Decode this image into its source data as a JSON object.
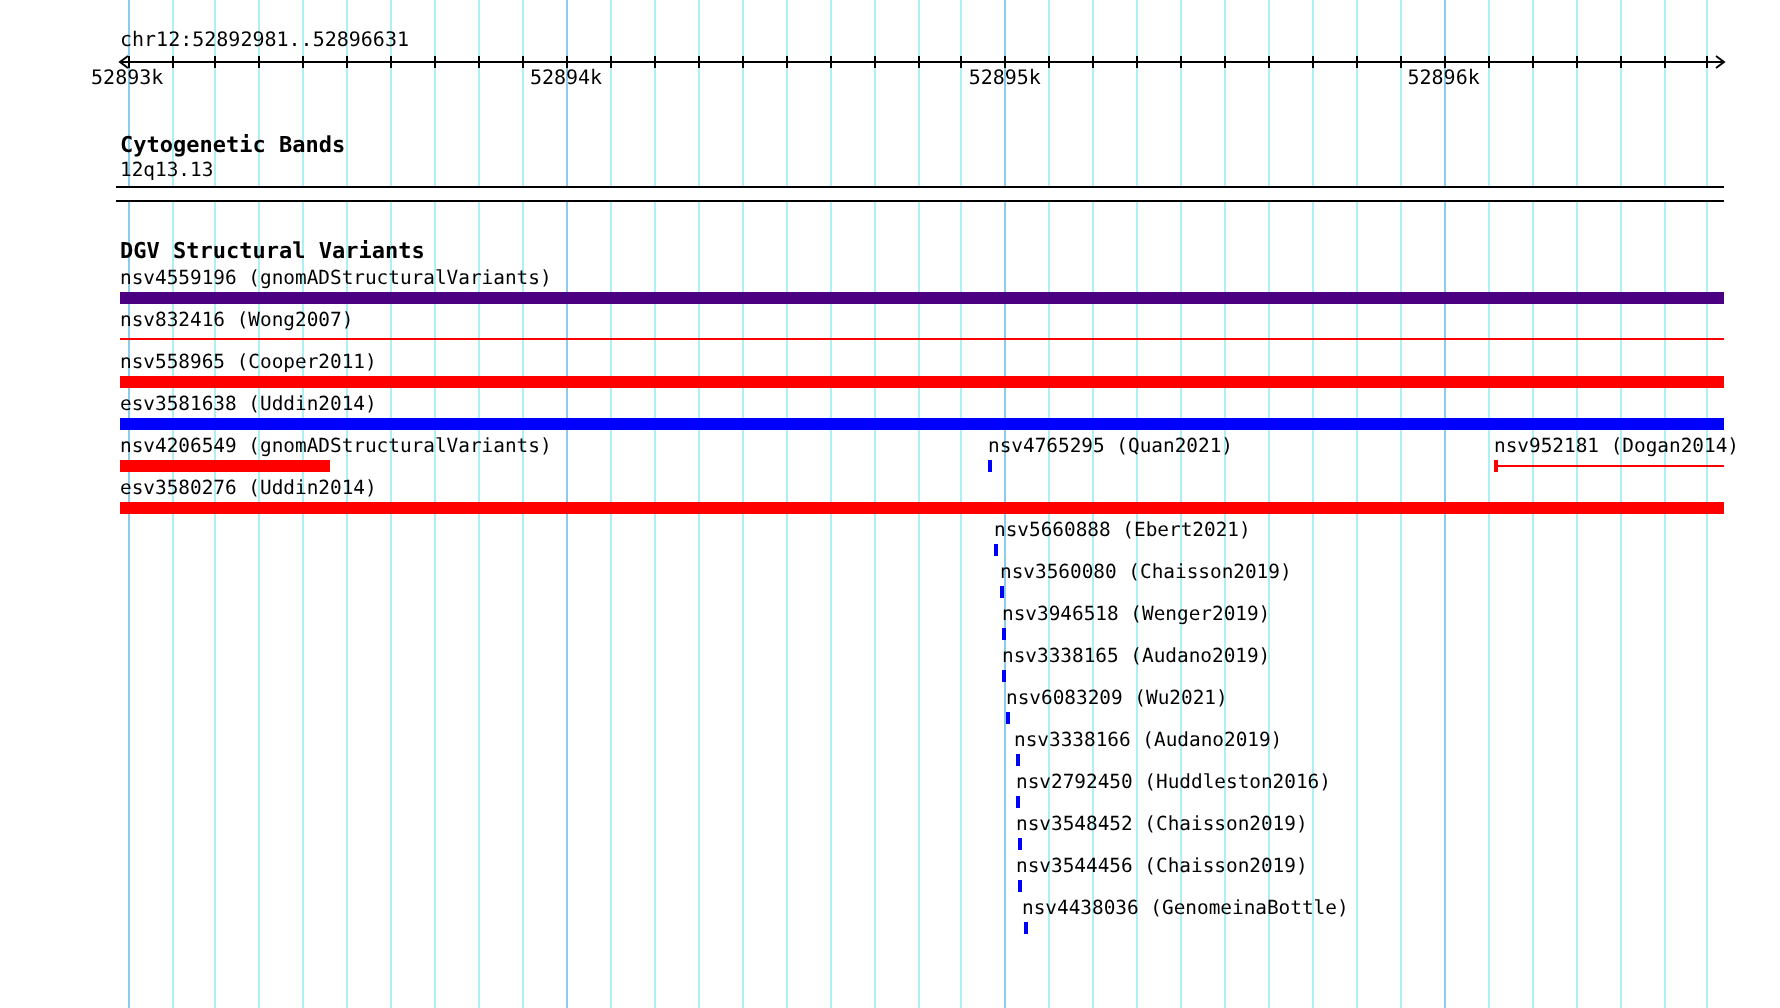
{
  "ruler": {
    "region": "chr12:52892981..52896631",
    "ticks": [
      "52893k",
      "52894k",
      "52895k",
      "52896k"
    ]
  },
  "tracks": [
    {
      "title": "Cytogenetic Bands",
      "kind": "bands",
      "features": [
        {
          "label": "12q13.13"
        }
      ]
    },
    {
      "title": "DGV Structural Variants",
      "kind": "variants",
      "features": [
        {
          "label": "nsv4559196 (gnomADStructuralVariants)",
          "kind": "bar",
          "color": "#4b0082"
        },
        {
          "label": "nsv832416 (Wong2007)",
          "kind": "line",
          "color": "#ff0000"
        },
        {
          "label": "nsv558965 (Cooper2011)",
          "kind": "bar",
          "color": "#ff0000"
        },
        {
          "label": "esv3581638 (Uddin2014)",
          "kind": "bar",
          "color": "#0000ff"
        },
        {
          "label": "nsv4206549 (gnomADStructuralVariants)",
          "kind": "bar",
          "color": "#ff0000"
        },
        {
          "label": "nsv4765295 (Quan2021)",
          "kind": "bar",
          "color": "#0000ff"
        },
        {
          "label": "nsv952181 (Dogan2014)",
          "kind": "capped-line",
          "color": "#ff0000"
        },
        {
          "label": "esv3580276 (Uddin2014)",
          "kind": "bar",
          "color": "#ff0000"
        },
        {
          "label": "nsv5660888 (Ebert2021)",
          "kind": "bar",
          "color": "#0000ff"
        },
        {
          "label": "nsv3560080 (Chaisson2019)",
          "kind": "bar",
          "color": "#0000ff"
        },
        {
          "label": "nsv3946518 (Wenger2019)",
          "kind": "bar",
          "color": "#0000ff"
        },
        {
          "label": "nsv3338165 (Audano2019)",
          "kind": "bar",
          "color": "#0000ff"
        },
        {
          "label": "nsv6083209 (Wu2021)",
          "kind": "bar",
          "color": "#0000ff"
        },
        {
          "label": "nsv3338166 (Audano2019)",
          "kind": "bar",
          "color": "#0000ff"
        },
        {
          "label": "nsv2792450 (Huddleston2016)",
          "kind": "bar",
          "color": "#0000ff"
        },
        {
          "label": "nsv3548452 (Chaisson2019)",
          "kind": "bar",
          "color": "#0000ff"
        },
        {
          "label": "nsv3544456 (Chaisson2019)",
          "kind": "bar",
          "color": "#0000ff"
        },
        {
          "label": "nsv4438036 (GenomeinaBottle)",
          "kind": "bar",
          "color": "#0000ff"
        }
      ]
    }
  ]
}
